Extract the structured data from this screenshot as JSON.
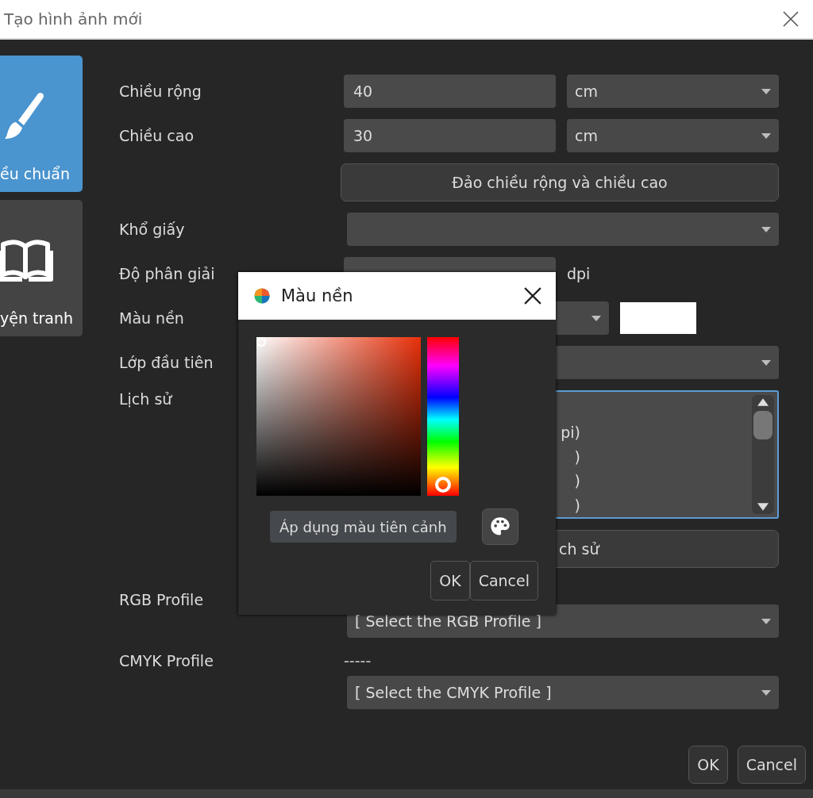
{
  "window": {
    "title": "Tạo hình ảnh mới"
  },
  "sidebar": {
    "items": [
      {
        "label": "ều chuẩn",
        "kind": "brush",
        "selected": true
      },
      {
        "label": "yện tranh",
        "kind": "book",
        "selected": false
      }
    ]
  },
  "form": {
    "width": {
      "label": "Chiều rộng",
      "value": "40",
      "unit": "cm"
    },
    "height": {
      "label": "Chiều cao",
      "value": "30",
      "unit": "cm"
    },
    "swap_button": "Đảo chiều rộng và chiều cao",
    "paper_size": {
      "label": "Khổ giấy"
    },
    "resolution": {
      "label": "Độ phân giải",
      "unit": "dpi"
    },
    "background_color": {
      "label": "Màu nền"
    },
    "first_layer": {
      "label": "Lớp đầu tiên"
    },
    "history": {
      "label": "Lịch sử",
      "items": [
        "pi)",
        ")",
        ")",
        ")"
      ],
      "button": "ch sử"
    },
    "rgb_profile": {
      "label": "RGB Profile",
      "value": "[ Select the RGB Profile ]"
    },
    "cmyk_profile": {
      "label": "CMYK Profile",
      "status": "-----",
      "value": "[ Select the CMYK Profile ]"
    }
  },
  "color_dialog": {
    "title": "Màu nền",
    "hue_slider": {
      "level": 0.98
    },
    "apply_button": "Áp dụng màu tiên cảnh",
    "buttons": [
      "OK",
      "Cancel"
    ]
  },
  "buttons": [
    "OK",
    "Cancel"
  ]
}
